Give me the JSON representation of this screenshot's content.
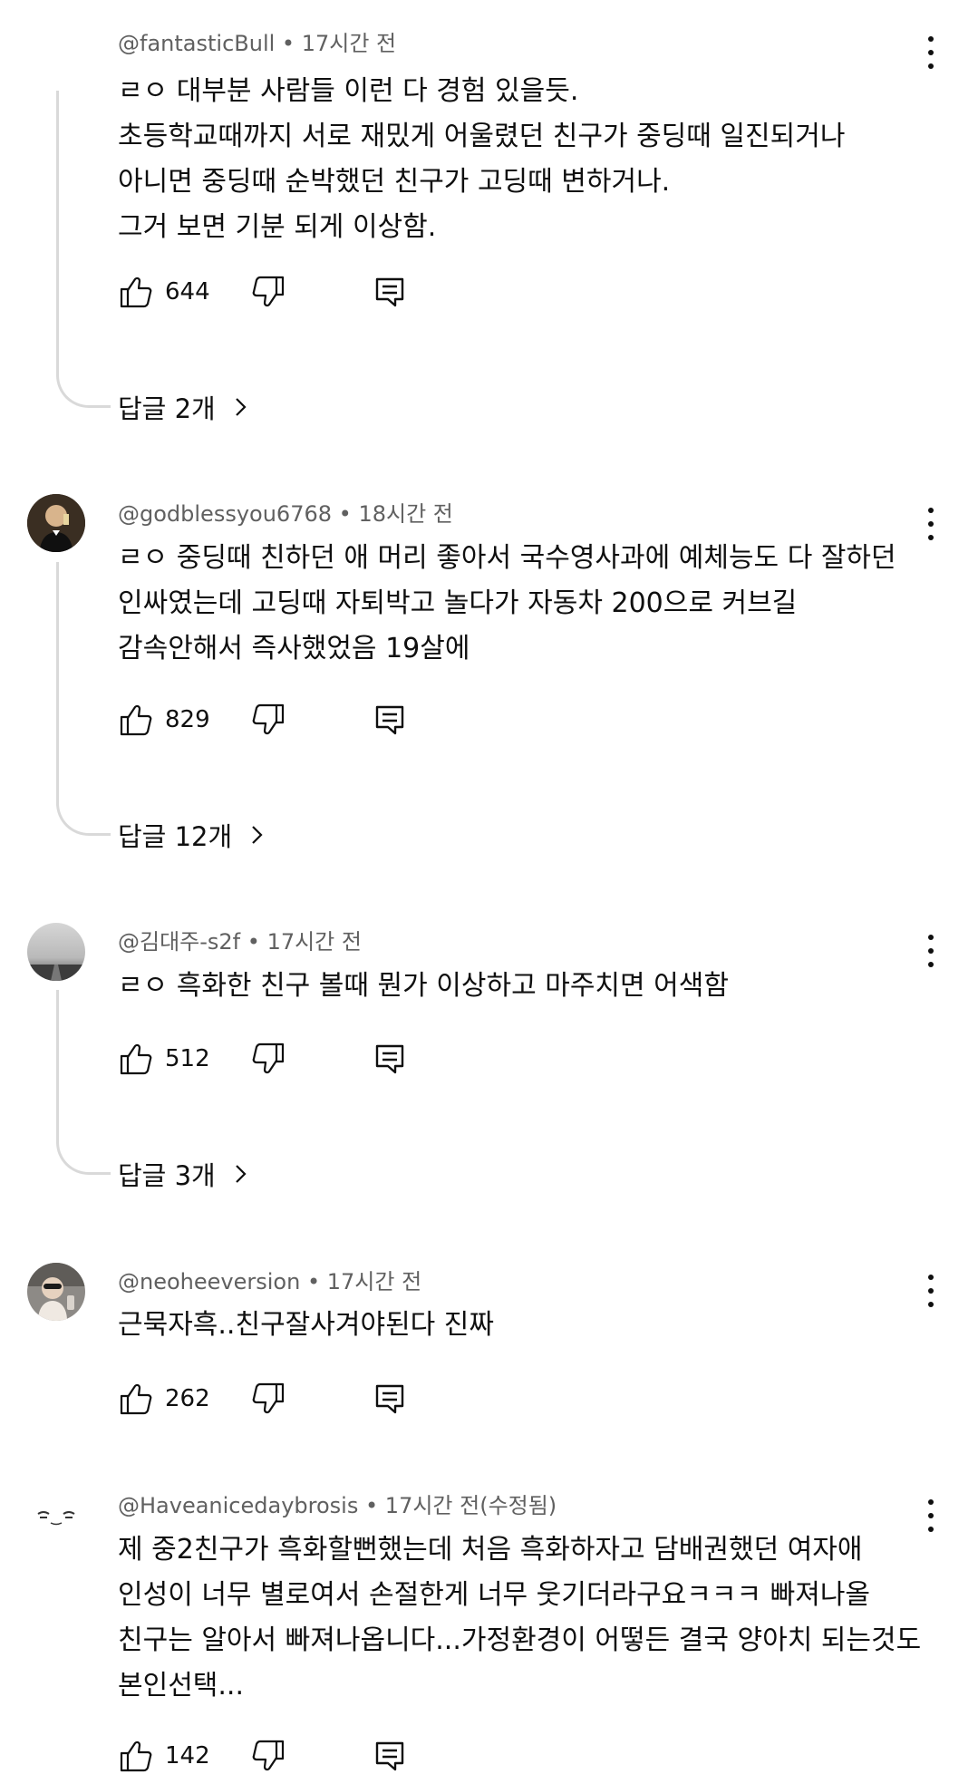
{
  "comments": [
    {
      "author": "@fantasticBull",
      "time": "17시간 전",
      "lines": [
        "ㄹㅇ 대부분 사람들 이런 다 경험 있을듯.",
        "초등학교때까지 서로 재밌게 어울렸던 친구가 중딩때 일진되거나",
        "아니면 중딩때 순박했던 친구가 고딩때 변하거나.",
        "그거 보면 기분 되게 이상함."
      ],
      "likes": "644",
      "replies": "답글 2개"
    },
    {
      "author": "@godblessyou6768",
      "time": "18시간 전",
      "lines": [
        "ㄹㅇ 중딩때 친하던 애 머리 좋아서 국수영사과에 예체능도 다 잘하던",
        "인싸였는데 고딩때 자퇴박고 놀다가 자동차 200으로 커브길",
        "감속안해서 즉사했었음 19살에"
      ],
      "likes": "829",
      "replies": "답글 12개"
    },
    {
      "author": "@김대주-s2f",
      "time": "17시간 전",
      "lines": [
        "ㄹㅇ 흑화한 친구 볼때 뭔가 이상하고 마주치면 어색함"
      ],
      "likes": "512",
      "replies": "답글 3개"
    },
    {
      "author": "@neoheeversion",
      "time": "17시간 전",
      "lines": [
        "근묵자흑..친구잘사겨야된다 진짜"
      ],
      "likes": "262"
    },
    {
      "author": "@Haveanicedaybrosis",
      "time": "17시간 전(수정됨)",
      "lines": [
        "제 중2친구가 흑화할뻔했는데 처음 흑화하자고 담배권했던 여자애",
        "인성이 너무 별로여서 손절한게 너무 웃기더라구요ㅋㅋㅋ 빠져나올",
        "친구는 알아서 빠져나옵니다...가정환경이 어떻든 결국 양아치 되는것도",
        "본인선택..."
      ],
      "likes": "142"
    }
  ],
  "meta_separator": "•",
  "icons": {
    "like": "thumbs-up-icon",
    "dislike": "thumbs-down-icon",
    "reply": "comment-reply-icon",
    "more": "more-vert-icon",
    "chevron": "chevron-right-icon"
  }
}
